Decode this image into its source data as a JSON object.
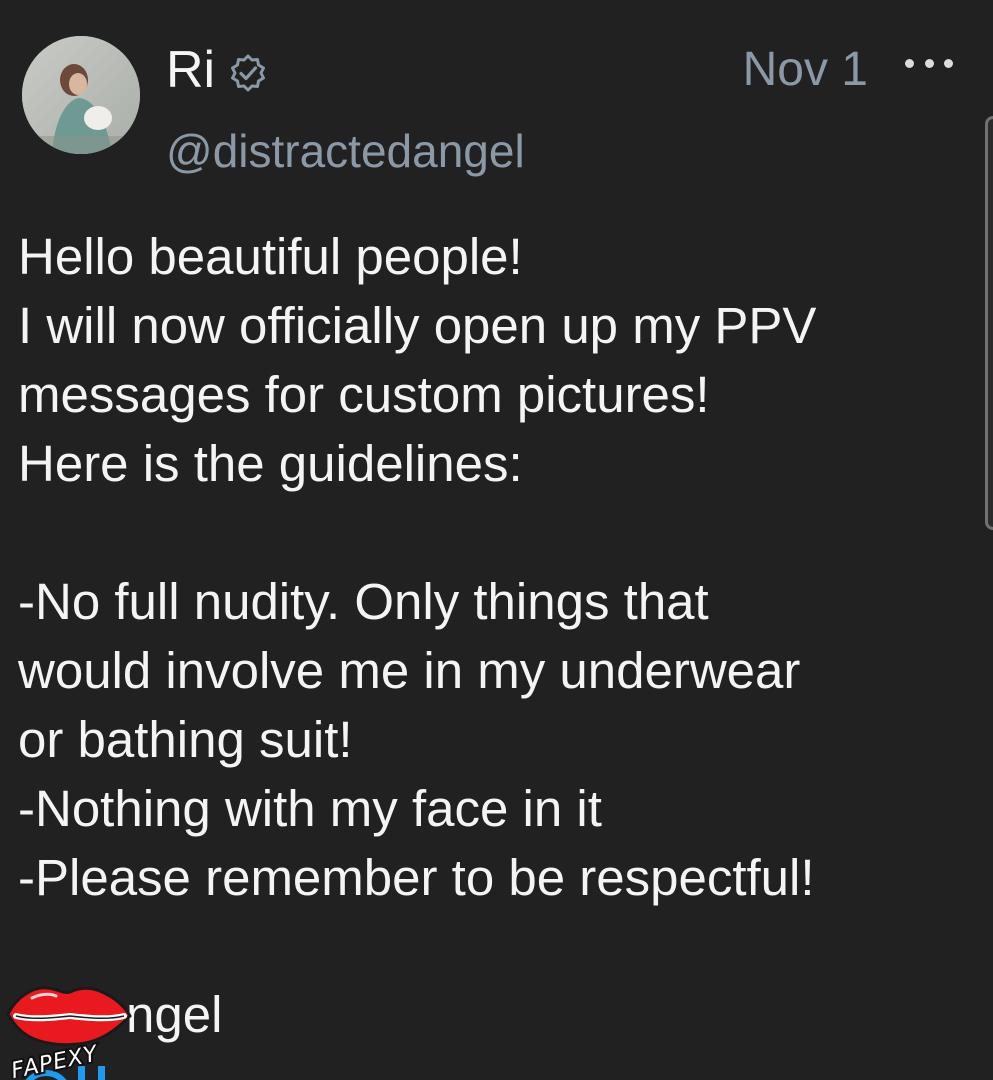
{
  "post": {
    "author": {
      "display_name": "Ri",
      "handle": "@distractedangel",
      "verified": true
    },
    "date": "Nov 1",
    "menu_icon": "more-horizontal-icon",
    "body_lines": [
      "Hello beautiful people!",
      "I will now officially open up my PPV",
      "messages for custom pictures!",
      "Here is the guidelines:",
      "",
      "-No full nudity. Only things that",
      "would involve me in my underwear",
      "or bathing suit!",
      "-Nothing with my face in it",
      "-Please remember to be respectful!"
    ],
    "signature_visible": "ngel"
  },
  "watermark": {
    "text": "FAPEXY",
    "icon": "red-lips-icon"
  },
  "colors": {
    "background": "#212121",
    "text": "#f4f4f4",
    "muted": "#8b98a5",
    "link": "#1d9bf0",
    "watermark_red": "#e8191f"
  }
}
